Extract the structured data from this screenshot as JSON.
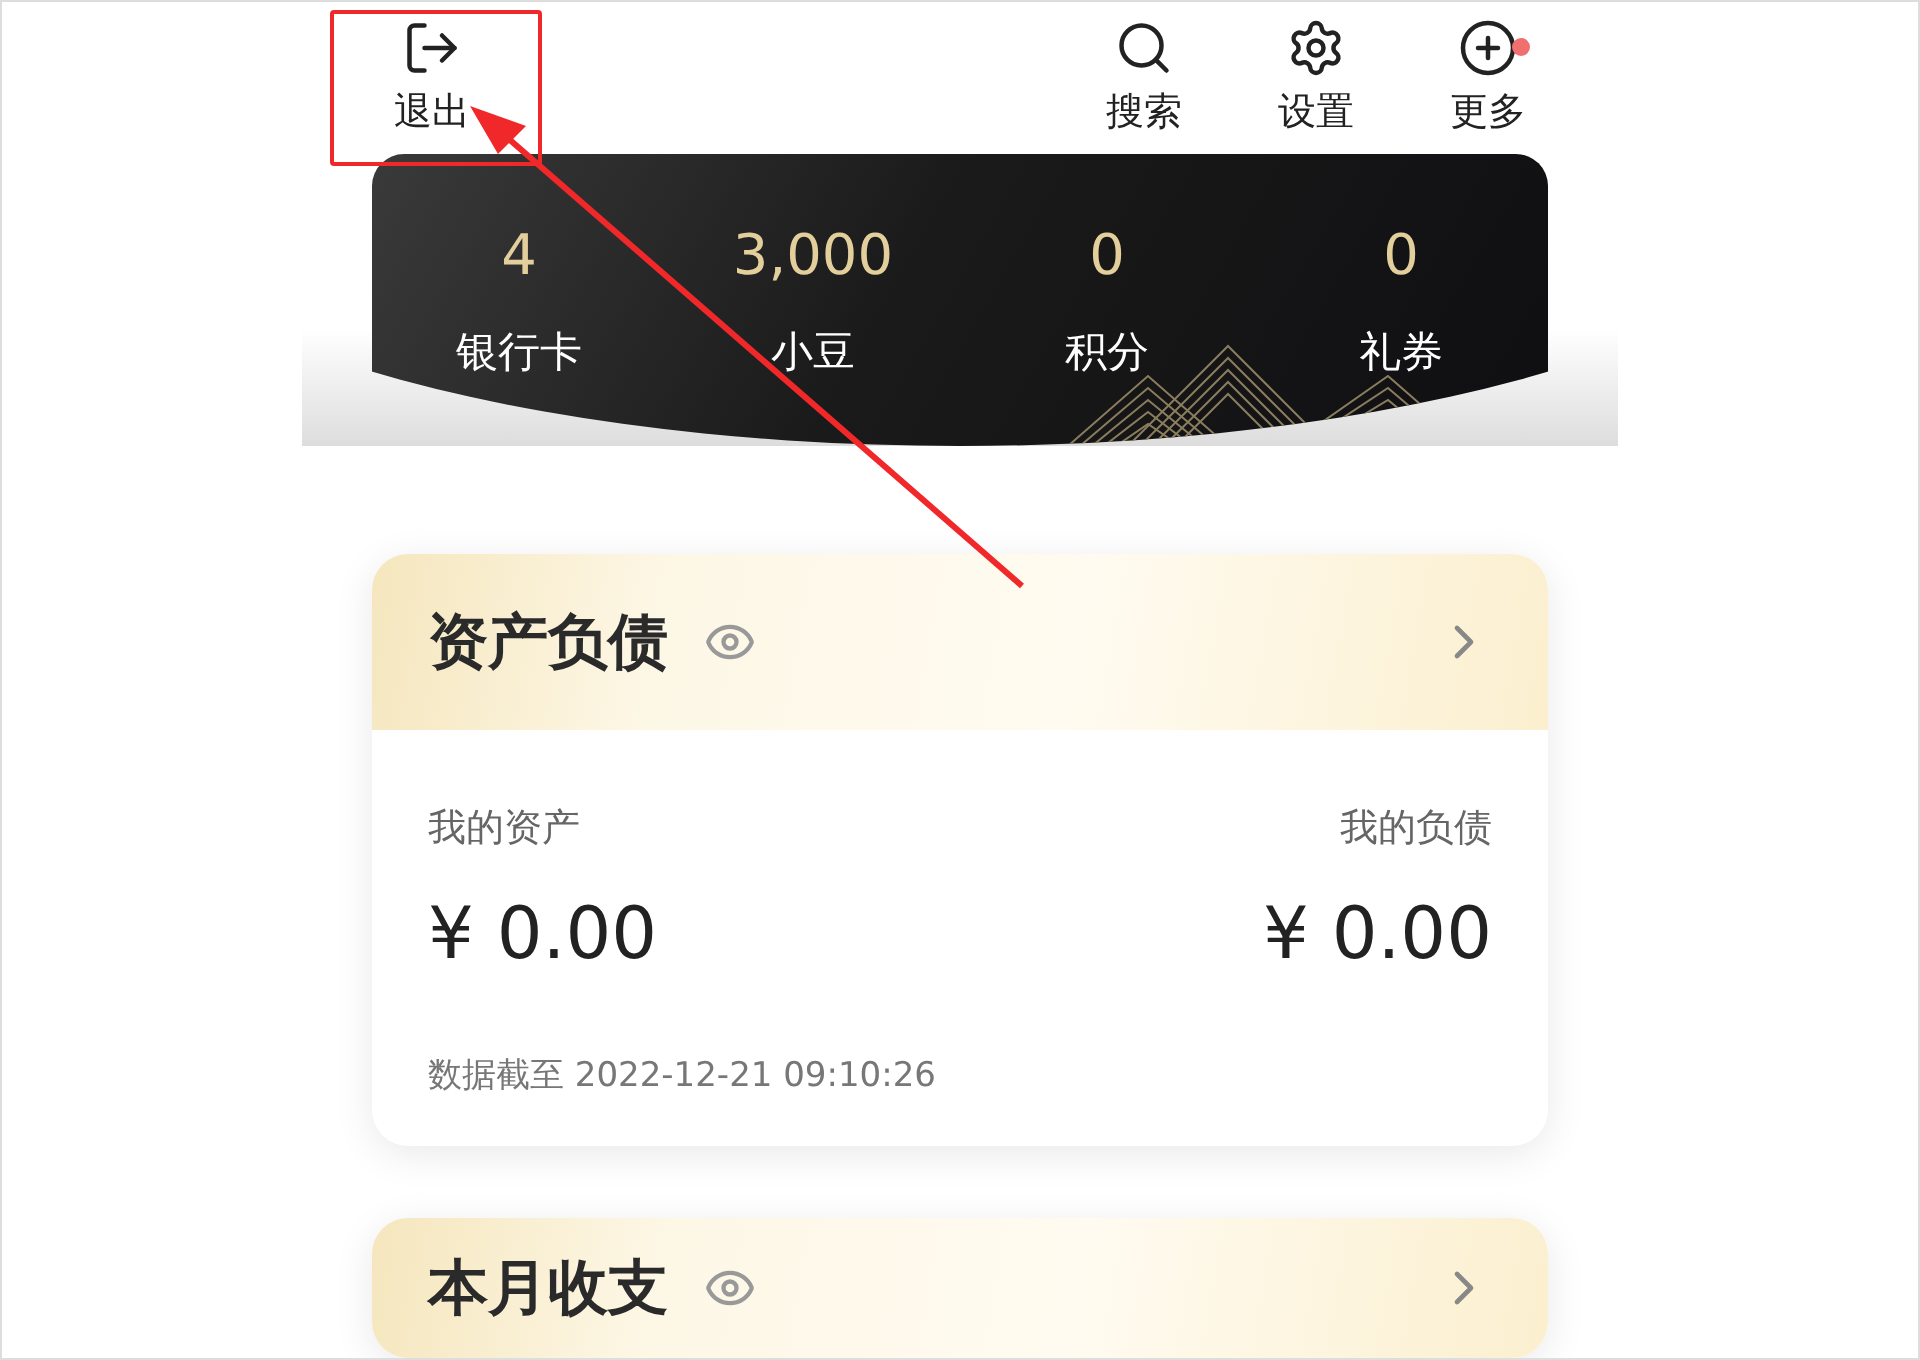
{
  "header": {
    "exit": {
      "label": "退出"
    },
    "actions": [
      {
        "kind": "search",
        "label": "搜索",
        "badge": false
      },
      {
        "kind": "settings",
        "label": "设置",
        "badge": false
      },
      {
        "kind": "more",
        "label": "更多",
        "badge": true
      }
    ]
  },
  "stats": [
    {
      "value": "4",
      "label": "银行卡"
    },
    {
      "value": "3,000",
      "label": "小豆"
    },
    {
      "value": "0",
      "label": "积分"
    },
    {
      "value": "0",
      "label": "礼券"
    }
  ],
  "assets_card": {
    "title": "资产负债",
    "assets_label": "我的资产",
    "assets_value": "¥ 0.00",
    "liabilities_label": "我的负债",
    "liabilities_value": "¥ 0.00",
    "updated": "数据截至 2022-12-21 09:10:26"
  },
  "next_card": {
    "title": "本月收支"
  }
}
